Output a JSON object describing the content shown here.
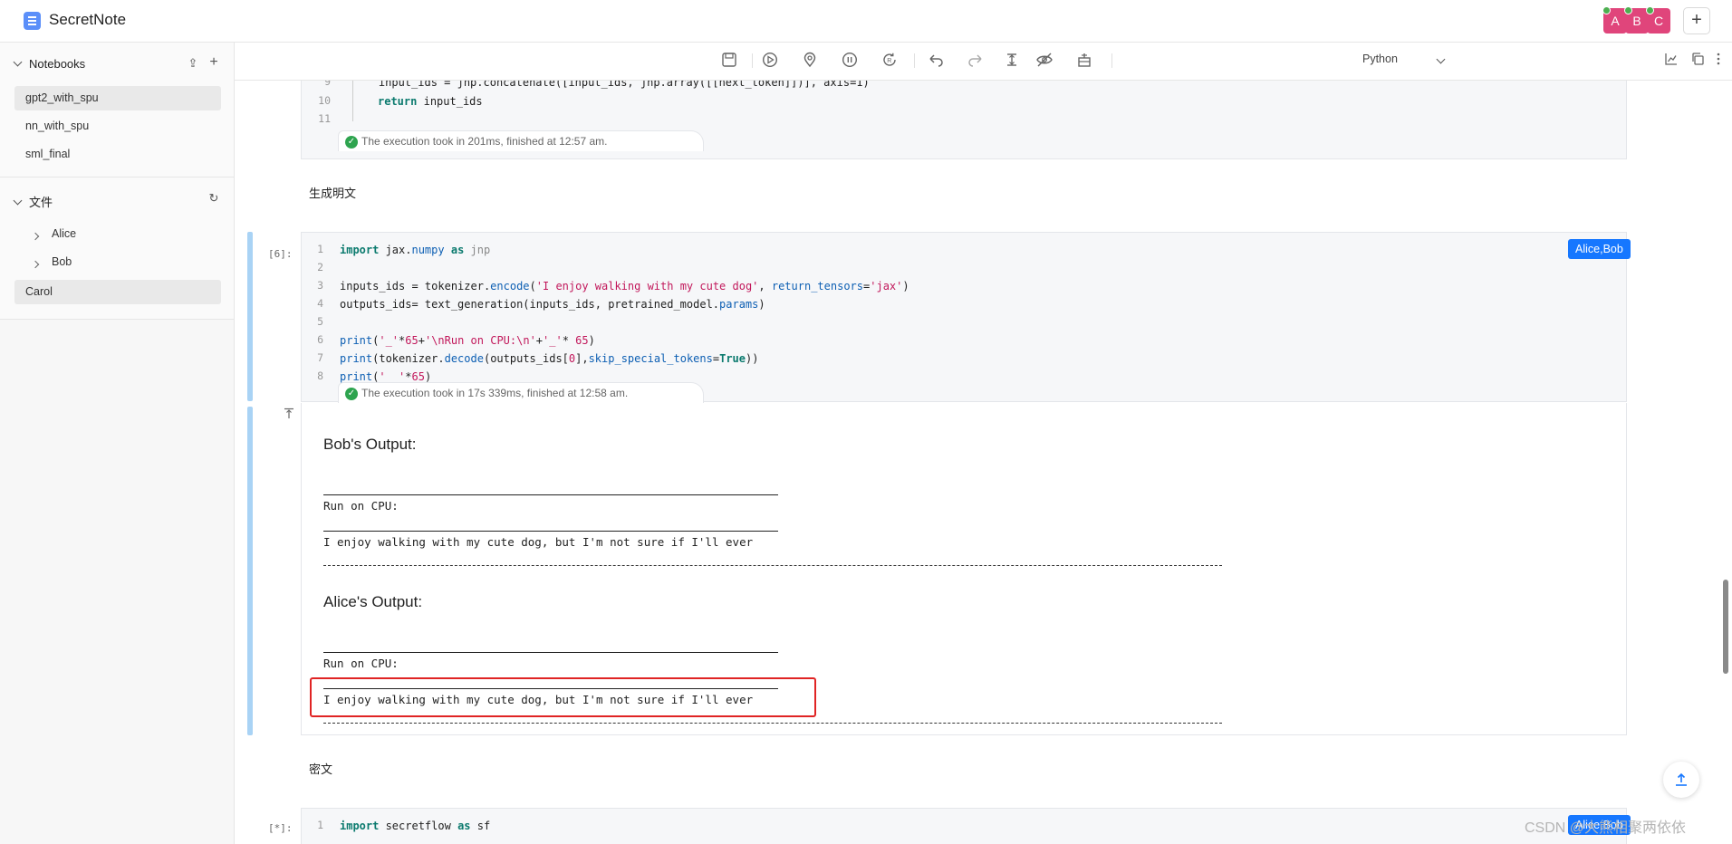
{
  "app": {
    "title": "SecretNote"
  },
  "header": {
    "avatars": [
      {
        "letter": "A",
        "color": "#e0457b"
      },
      {
        "letter": "B",
        "color": "#e0457b"
      },
      {
        "letter": "C",
        "color": "#e0457b"
      }
    ],
    "add_icon": "plus-icon",
    "add_label": "+"
  },
  "sidebar": {
    "notebooks_label": "Notebooks",
    "notebooks": [
      {
        "label": "gpt2_with_spu",
        "selected": true
      },
      {
        "label": "nn_with_spu",
        "selected": false
      },
      {
        "label": "sml_final",
        "selected": false
      }
    ],
    "files_label": "文件",
    "files": [
      {
        "label": "Alice",
        "expandable": true
      },
      {
        "label": "Bob",
        "expandable": true
      },
      {
        "label": "Carol",
        "selected": true
      }
    ]
  },
  "toolbar": {
    "icons": [
      "save-icon",
      "run-icon",
      "locate-icon",
      "pause-icon",
      "restart-icon",
      "undo-icon",
      "redo-icon",
      "collapse-icon",
      "hide-icon",
      "debug-icon"
    ],
    "language": "Python",
    "right_icons": [
      "chart-icon",
      "copy-icon",
      "more-icon"
    ]
  },
  "cells": [
    {
      "code_tail": [
        {
          "n": "9",
          "text": "    input_ids = jnp.concatenate([input_ids, jnp.array([[next_token]])], axis=1)"
        },
        {
          "n": "10",
          "text": "return input_ids"
        },
        {
          "n": "11",
          "text": ""
        }
      ],
      "exec": "The execution took in 201ms, finished at 12:57 am."
    },
    {
      "markdown": "生成明文",
      "prompt": "[6]:",
      "badge": "Alice,Bob",
      "code": [
        {
          "n": "1",
          "text": "import jax.numpy as jnp"
        },
        {
          "n": "2",
          "text": ""
        },
        {
          "n": "3",
          "text": "inputs_ids = tokenizer.encode('I enjoy walking with my cute dog', return_tensors='jax')"
        },
        {
          "n": "4",
          "text": "outputs_ids= text_generation(inputs_ids, pretrained_model.params)"
        },
        {
          "n": "5",
          "text": ""
        },
        {
          "n": "6",
          "text": "print('_'*65+'\\nRun on CPU:\\n'+'_'* 65)"
        },
        {
          "n": "7",
          "text": "print(tokenizer.decode(outputs_ids[0],skip_special_tokens=True))"
        },
        {
          "n": "8",
          "text": "print('_ '*65)"
        }
      ],
      "exec": "The execution took in 17s 339ms, finished at 12:58 am.",
      "outputs": [
        {
          "title": "Bob's Output:",
          "run_label": "Run on CPU:",
          "text": "I enjoy walking with my cute dog, but I'm not sure if I'll ever"
        },
        {
          "title": "Alice's Output:",
          "run_label": "Run on CPU:",
          "text": "I enjoy walking with my cute dog, but I'm not sure if I'll ever"
        }
      ]
    },
    {
      "markdown": "密文",
      "prompt": "[*]:",
      "badge": "Alice,Bob",
      "code": [
        {
          "n": "1",
          "text": "import secretflow as sf"
        }
      ]
    }
  ],
  "watermark": "CSDN @大熊相聚两依依",
  "scroll_top_icon": "arrow-up-icon",
  "colors": {
    "accent": "#1677ff",
    "avatar": "#e0457b",
    "gutter": "#a9d3f5",
    "highlight": "#e02424",
    "success": "#2ea44f"
  }
}
